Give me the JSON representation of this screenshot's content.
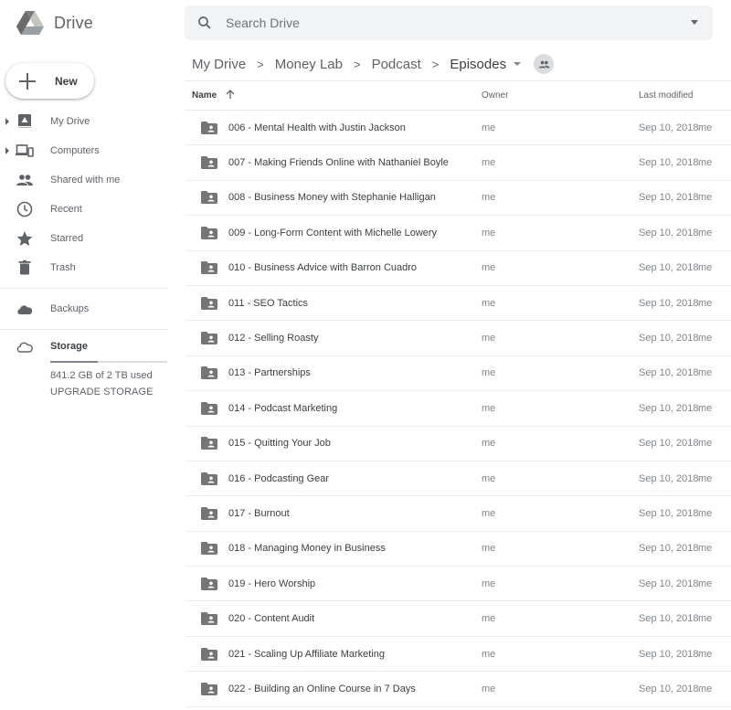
{
  "app": {
    "name": "Drive"
  },
  "search": {
    "placeholder": "Search Drive"
  },
  "new_button": {
    "label": "New"
  },
  "sidebar": {
    "items": [
      {
        "label": "My Drive",
        "icon": "my-drive-icon",
        "expandable": true
      },
      {
        "label": "Computers",
        "icon": "computers-icon",
        "expandable": true
      },
      {
        "label": "Shared with me",
        "icon": "people-icon",
        "expandable": false
      },
      {
        "label": "Recent",
        "icon": "clock-icon",
        "expandable": false
      },
      {
        "label": "Starred",
        "icon": "star-icon",
        "expandable": false
      },
      {
        "label": "Trash",
        "icon": "trash-icon",
        "expandable": false
      }
    ],
    "backups": {
      "label": "Backups",
      "icon": "cloud-filled-icon"
    },
    "storage": {
      "label": "Storage",
      "icon": "cloud-outline-icon",
      "used_text": "841.2 GB of 2 TB used",
      "used_fraction": 0.41,
      "upgrade_label": "UPGRADE STORAGE"
    }
  },
  "breadcrumb": {
    "items": [
      "My Drive",
      "Money Lab",
      "Podcast",
      "Episodes"
    ],
    "separator": ">",
    "shared_icon": "shared-folder-icon"
  },
  "table": {
    "columns": {
      "name": "Name",
      "owner": "Owner",
      "modified": "Last modified"
    },
    "sort": {
      "column": "Name",
      "direction": "ascending"
    },
    "rows": [
      {
        "name": "006 - Mental Health with Justin Jackson",
        "owner": "me",
        "modified": "Sep 10, 2018",
        "modified_by": "me"
      },
      {
        "name": "007 - Making Friends Online with Nathaniel Boyle",
        "owner": "me",
        "modified": "Sep 10, 2018",
        "modified_by": "me"
      },
      {
        "name": "008 - Business Money with Stephanie Halligan",
        "owner": "me",
        "modified": "Sep 10, 2018",
        "modified_by": "me"
      },
      {
        "name": "009 - Long-Form Content with Michelle Lowery",
        "owner": "me",
        "modified": "Sep 10, 2018",
        "modified_by": "me"
      },
      {
        "name": "010 - Business Advice with Barron Cuadro",
        "owner": "me",
        "modified": "Sep 10, 2018",
        "modified_by": "me"
      },
      {
        "name": "011 - SEO Tactics",
        "owner": "me",
        "modified": "Sep 10, 2018",
        "modified_by": "me"
      },
      {
        "name": "012 - Selling Roasty",
        "owner": "me",
        "modified": "Sep 10, 2018",
        "modified_by": "me"
      },
      {
        "name": "013 - Partnerships",
        "owner": "me",
        "modified": "Sep 10, 2018",
        "modified_by": "me"
      },
      {
        "name": "014 - Podcast Marketing",
        "owner": "me",
        "modified": "Sep 10, 2018",
        "modified_by": "me"
      },
      {
        "name": "015 - Quitting Your Job",
        "owner": "me",
        "modified": "Sep 10, 2018",
        "modified_by": "me"
      },
      {
        "name": "016 - Podcasting Gear",
        "owner": "me",
        "modified": "Sep 10, 2018",
        "modified_by": "me"
      },
      {
        "name": "017 - Burnout",
        "owner": "me",
        "modified": "Sep 10, 2018",
        "modified_by": "me"
      },
      {
        "name": "018 - Managing Money in Business",
        "owner": "me",
        "modified": "Sep 10, 2018",
        "modified_by": "me"
      },
      {
        "name": "019 - Hero Worship",
        "owner": "me",
        "modified": "Sep 10, 2018",
        "modified_by": "me"
      },
      {
        "name": "020 - Content Audit",
        "owner": "me",
        "modified": "Sep 10, 2018",
        "modified_by": "me"
      },
      {
        "name": "021 - Scaling Up Affiliate Marketing",
        "owner": "me",
        "modified": "Sep 10, 2018",
        "modified_by": "me"
      },
      {
        "name": "022 - Building an Online Course in 7 Days",
        "owner": "me",
        "modified": "Sep 10, 2018",
        "modified_by": "me"
      }
    ]
  }
}
